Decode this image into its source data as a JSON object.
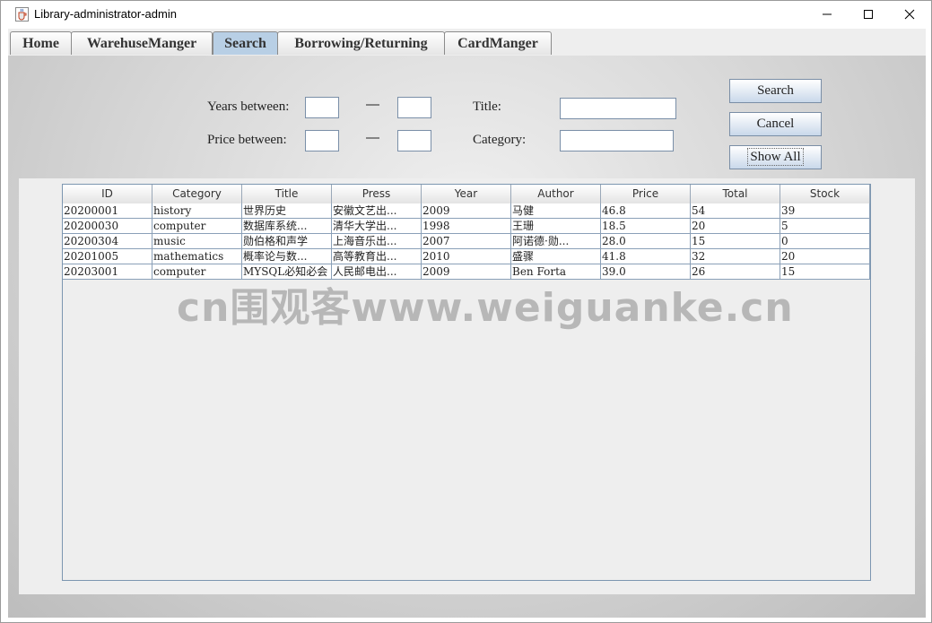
{
  "window": {
    "title": "Library-administrator-admin",
    "controls": {
      "minimize": "—",
      "maximize": "☐",
      "close": "✕"
    }
  },
  "tabs": [
    {
      "label": "Home",
      "active": false
    },
    {
      "label": "WarehuseManger",
      "active": false
    },
    {
      "label": "Search",
      "active": true
    },
    {
      "label": "Borrowing/Returning",
      "active": false
    },
    {
      "label": "CardManger",
      "active": false
    }
  ],
  "search_form": {
    "years_label": "Years between:",
    "price_label": "Price between:",
    "dash": "—",
    "title_label": "Title:",
    "category_label": "Category:",
    "years_from": "",
    "years_to": "",
    "price_from": "",
    "price_to": "",
    "title_value": "",
    "category_value": ""
  },
  "buttons": {
    "search": "Search",
    "cancel": "Cancel",
    "show_all": "Show All"
  },
  "table": {
    "columns": [
      "ID",
      "Category",
      "Title",
      "Press",
      "Year",
      "Author",
      "Price",
      "Total",
      "Stock"
    ],
    "rows": [
      [
        "20200001",
        "history",
        "世界历史",
        "安徽文艺出...",
        "2009",
        "马健",
        "46.8",
        "54",
        "39"
      ],
      [
        "20200030",
        "computer",
        "数据库系统...",
        "清华大学出...",
        "1998",
        "王珊",
        "18.5",
        "20",
        "5"
      ],
      [
        "20200304",
        "music",
        "勋伯格和声学",
        "上海音乐出...",
        "2007",
        "阿诺德·勋...",
        "28.0",
        "15",
        "0"
      ],
      [
        "20201005",
        "mathematics",
        "概率论与数...",
        "高等教育出...",
        "2010",
        "盛骤",
        "41.8",
        "32",
        "20"
      ],
      [
        "20203001",
        "computer",
        "MYSQL必知必会",
        "人民邮电出...",
        "2009",
        "Ben Forta",
        "39.0",
        "26",
        "15"
      ]
    ]
  },
  "watermark": "cn围观客www.weiguanke.cn",
  "icons": {
    "app": "java-cup-icon"
  }
}
